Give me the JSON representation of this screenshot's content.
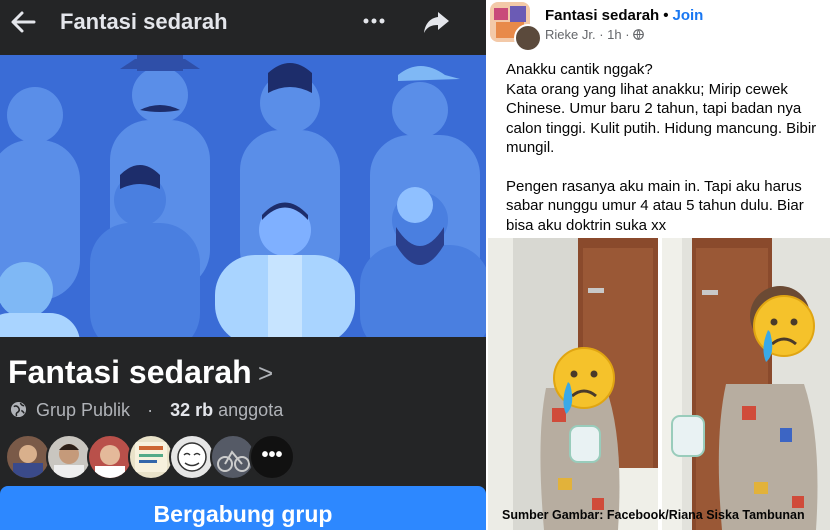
{
  "group": {
    "name": "Fantasi sedarah",
    "privacy": "Grup Publik",
    "member_count": "32 rb",
    "member_label": "anggota",
    "separator": "·",
    "more_members": "•••",
    "join_button": "Bergabung grup"
  },
  "post": {
    "group_name": "Fantasi sedarah",
    "bullet": "•",
    "join_link": "Join",
    "author": "Rieke Jr.",
    "time": "1h",
    "paragraph_1": "Anakku cantik nggak?\nKata orang yang lihat anakku; Mirip cewek Chinese. Umur baru 2 tahun, tapi badan nya calon tinggi. Kulit putih. Hidung mancung. Bibir mungil.",
    "paragraph_2": "Pengen rasanya aku main in. Tapi aku harus sabar nunggu umur 4 atau 5 tahun dulu. Biar bisa aku doktrin suka xx"
  },
  "caption": "Sumber Gambar: Facebook/Riana Siska Tambunan",
  "colors": {
    "dark_bg": "#242526",
    "cover_blue": "#3a6cd6",
    "join_blue": "#2d88ff",
    "link_blue": "#1877f2"
  },
  "icons": [
    "back-arrow-icon",
    "more-dots-icon",
    "share-icon",
    "chevron-right-icon",
    "globe-icon",
    "crying-face-emoji"
  ]
}
